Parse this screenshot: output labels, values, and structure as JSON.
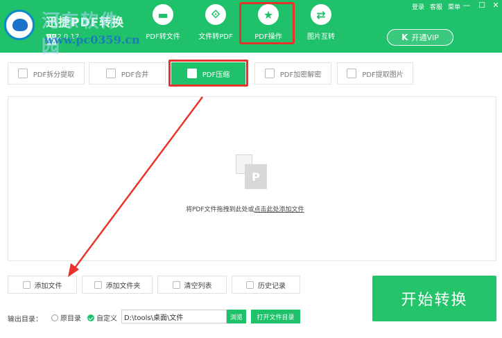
{
  "header": {
    "app_name": "迅捷PDF转换器",
    "version": "V1.2.0.17",
    "watermark_title": "河东软件园",
    "watermark_url": "www.pc0359.cn",
    "top_links": [
      "登录",
      "客服",
      "菜单"
    ],
    "window_controls": {
      "minimize": "—",
      "maximize": "☐",
      "close": "✕"
    },
    "nav": [
      {
        "label": "PDF转文件",
        "icon": "folder-icon",
        "glyph": "▬"
      },
      {
        "label": "文件转PDF",
        "icon": "acrobat-icon",
        "glyph": "⟐"
      },
      {
        "label": "PDF操作",
        "icon": "star-icon",
        "glyph": "★"
      },
      {
        "label": "图片互转",
        "icon": "swap-icon",
        "glyph": "⇄"
      }
    ],
    "vip_label": "开通VIP",
    "vip_glyph": "K"
  },
  "tabs": [
    {
      "label": "PDF拆分提取"
    },
    {
      "label": "PDF合并"
    },
    {
      "label": "PDF压缩"
    },
    {
      "label": "PDF加密解密"
    },
    {
      "label": "PDF提取图片"
    }
  ],
  "drop_zone": {
    "icon_glyph": "P",
    "text_prefix": "将PDF文件拖拽到此处或",
    "text_link": "点击此处添加文件"
  },
  "actions": {
    "add_file": "添加文件",
    "add_folder": "添加文件夹",
    "clear_list": "清空列表",
    "history": "历史记录"
  },
  "start_button": "开始转换",
  "output": {
    "label": "输出目录：",
    "option_original": "原目录",
    "option_custom": "自定义",
    "path": "D:\\tools\\桌面\\文件",
    "browse": "浏览",
    "open_dir": "打开文件目录"
  },
  "colors": {
    "brand_green": "#1fc26b",
    "annotation_red": "#e8322b"
  }
}
